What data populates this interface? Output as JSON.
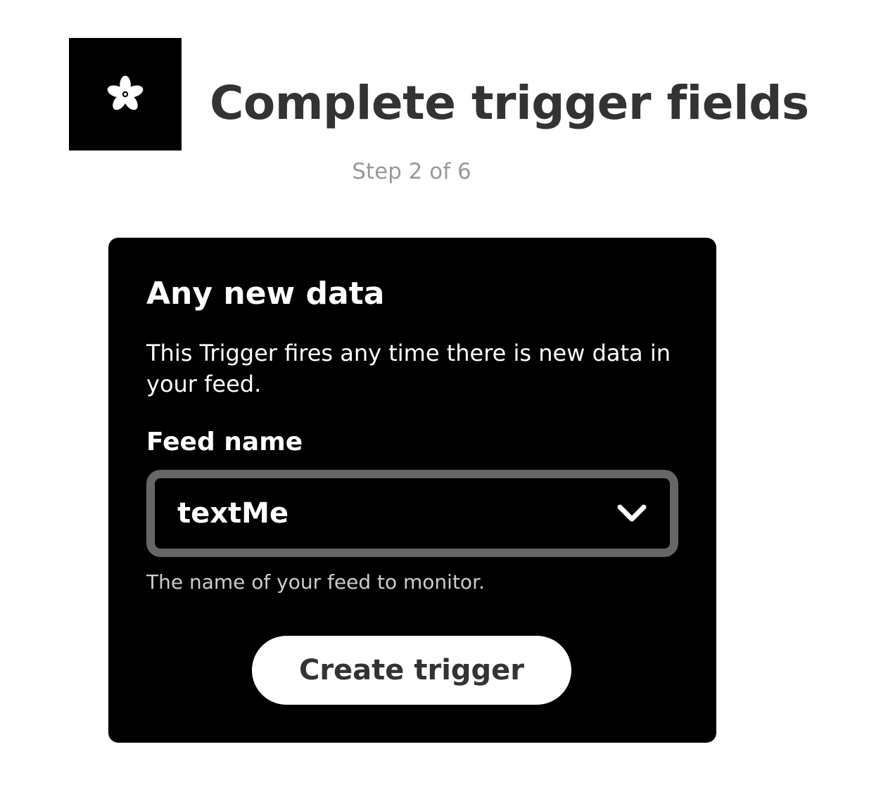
{
  "header": {
    "logo_icon": "adafruit-flower-icon",
    "title": "Complete trigger fields",
    "step": "Step 2 of 6"
  },
  "trigger_card": {
    "title": "Any new data",
    "description": "This Trigger fires any time there is new data in your feed.",
    "fields": [
      {
        "label": "Feed name",
        "value": "textMe",
        "helper": "The name of your feed to monitor.",
        "icon": "chevron-down-icon"
      }
    ],
    "submit_label": "Create trigger"
  },
  "colors": {
    "text_dark": "#333333",
    "text_muted": "#999999",
    "card_background": "#000000",
    "select_border": "#666666",
    "button_background": "#ffffff"
  }
}
